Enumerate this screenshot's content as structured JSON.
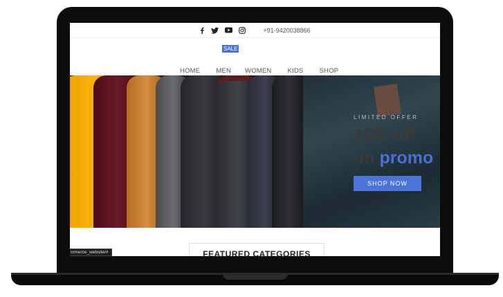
{
  "topbar": {
    "icons": [
      "facebook-icon",
      "twitter-icon",
      "youtube-icon",
      "instagram-icon"
    ],
    "phone": "+91-9420038866"
  },
  "nav": {
    "sale_badge": "SALE",
    "items": [
      {
        "label": "HOME"
      },
      {
        "label": "MEN"
      },
      {
        "label": "WOMEN"
      },
      {
        "label": "KIDS"
      },
      {
        "label": "SHOP"
      }
    ]
  },
  "hero": {
    "eyebrow": "LIMITED OFFER",
    "headline": "10% off",
    "subline_prefix": "on ",
    "subline_highlight": "promo",
    "button_label": "SHOP NOW"
  },
  "featured": {
    "title": "FEATURED CATEGORIES"
  },
  "status_bar": {
    "url": "mmerce_website/#"
  },
  "colors": {
    "accent": "#4a6fd6",
    "button": "#4a74d8",
    "laptop": "#0c0c0c"
  }
}
